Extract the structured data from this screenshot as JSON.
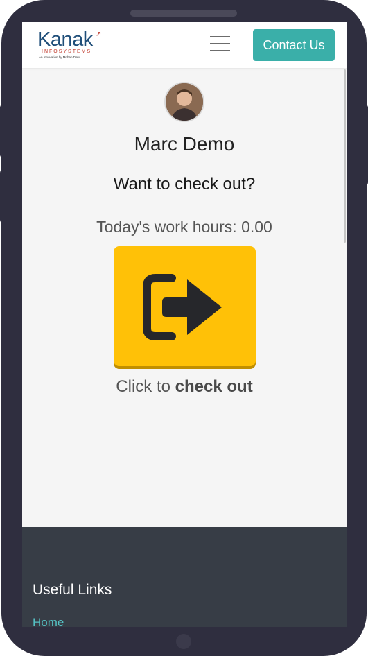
{
  "navbar": {
    "logo_text": "Kanak",
    "logo_subtext": "INFOSYSTEMS",
    "logo_tagline": "An Innovation by Mohan Dewi",
    "menu_icon": "hamburger-icon",
    "contact_label": "Contact Us"
  },
  "attendance": {
    "user_name": "Marc Demo",
    "prompt": "Want to check out?",
    "hours_text": "Today's work hours: 0.00",
    "button_icon": "sign-out-icon",
    "click_prefix": "Click to ",
    "click_action": "check out"
  },
  "footer": {
    "title": "Useful Links",
    "links": [
      "Home"
    ]
  },
  "colors": {
    "contact_button": "#3aafa9",
    "checkout_button": "#ffc107",
    "footer_bg": "#373d46",
    "link": "#55c2c5",
    "phone_frame": "#2f2e3f"
  }
}
